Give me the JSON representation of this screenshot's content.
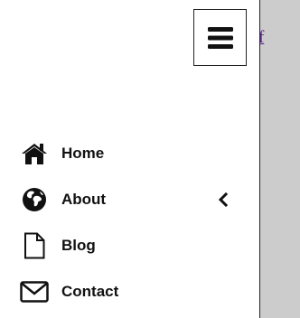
{
  "background": {
    "link_text": "ff",
    "color": "#cccccc"
  },
  "menu_toggle": {
    "icon": "hamburger-icon"
  },
  "nav": {
    "items": [
      {
        "label": "Home",
        "icon": "home-icon"
      },
      {
        "label": "About",
        "icon": "globe-icon",
        "expand_icon": "chevron-left-icon"
      },
      {
        "label": "Blog",
        "icon": "file-icon"
      },
      {
        "label": "Contact",
        "icon": "envelope-icon"
      }
    ]
  }
}
